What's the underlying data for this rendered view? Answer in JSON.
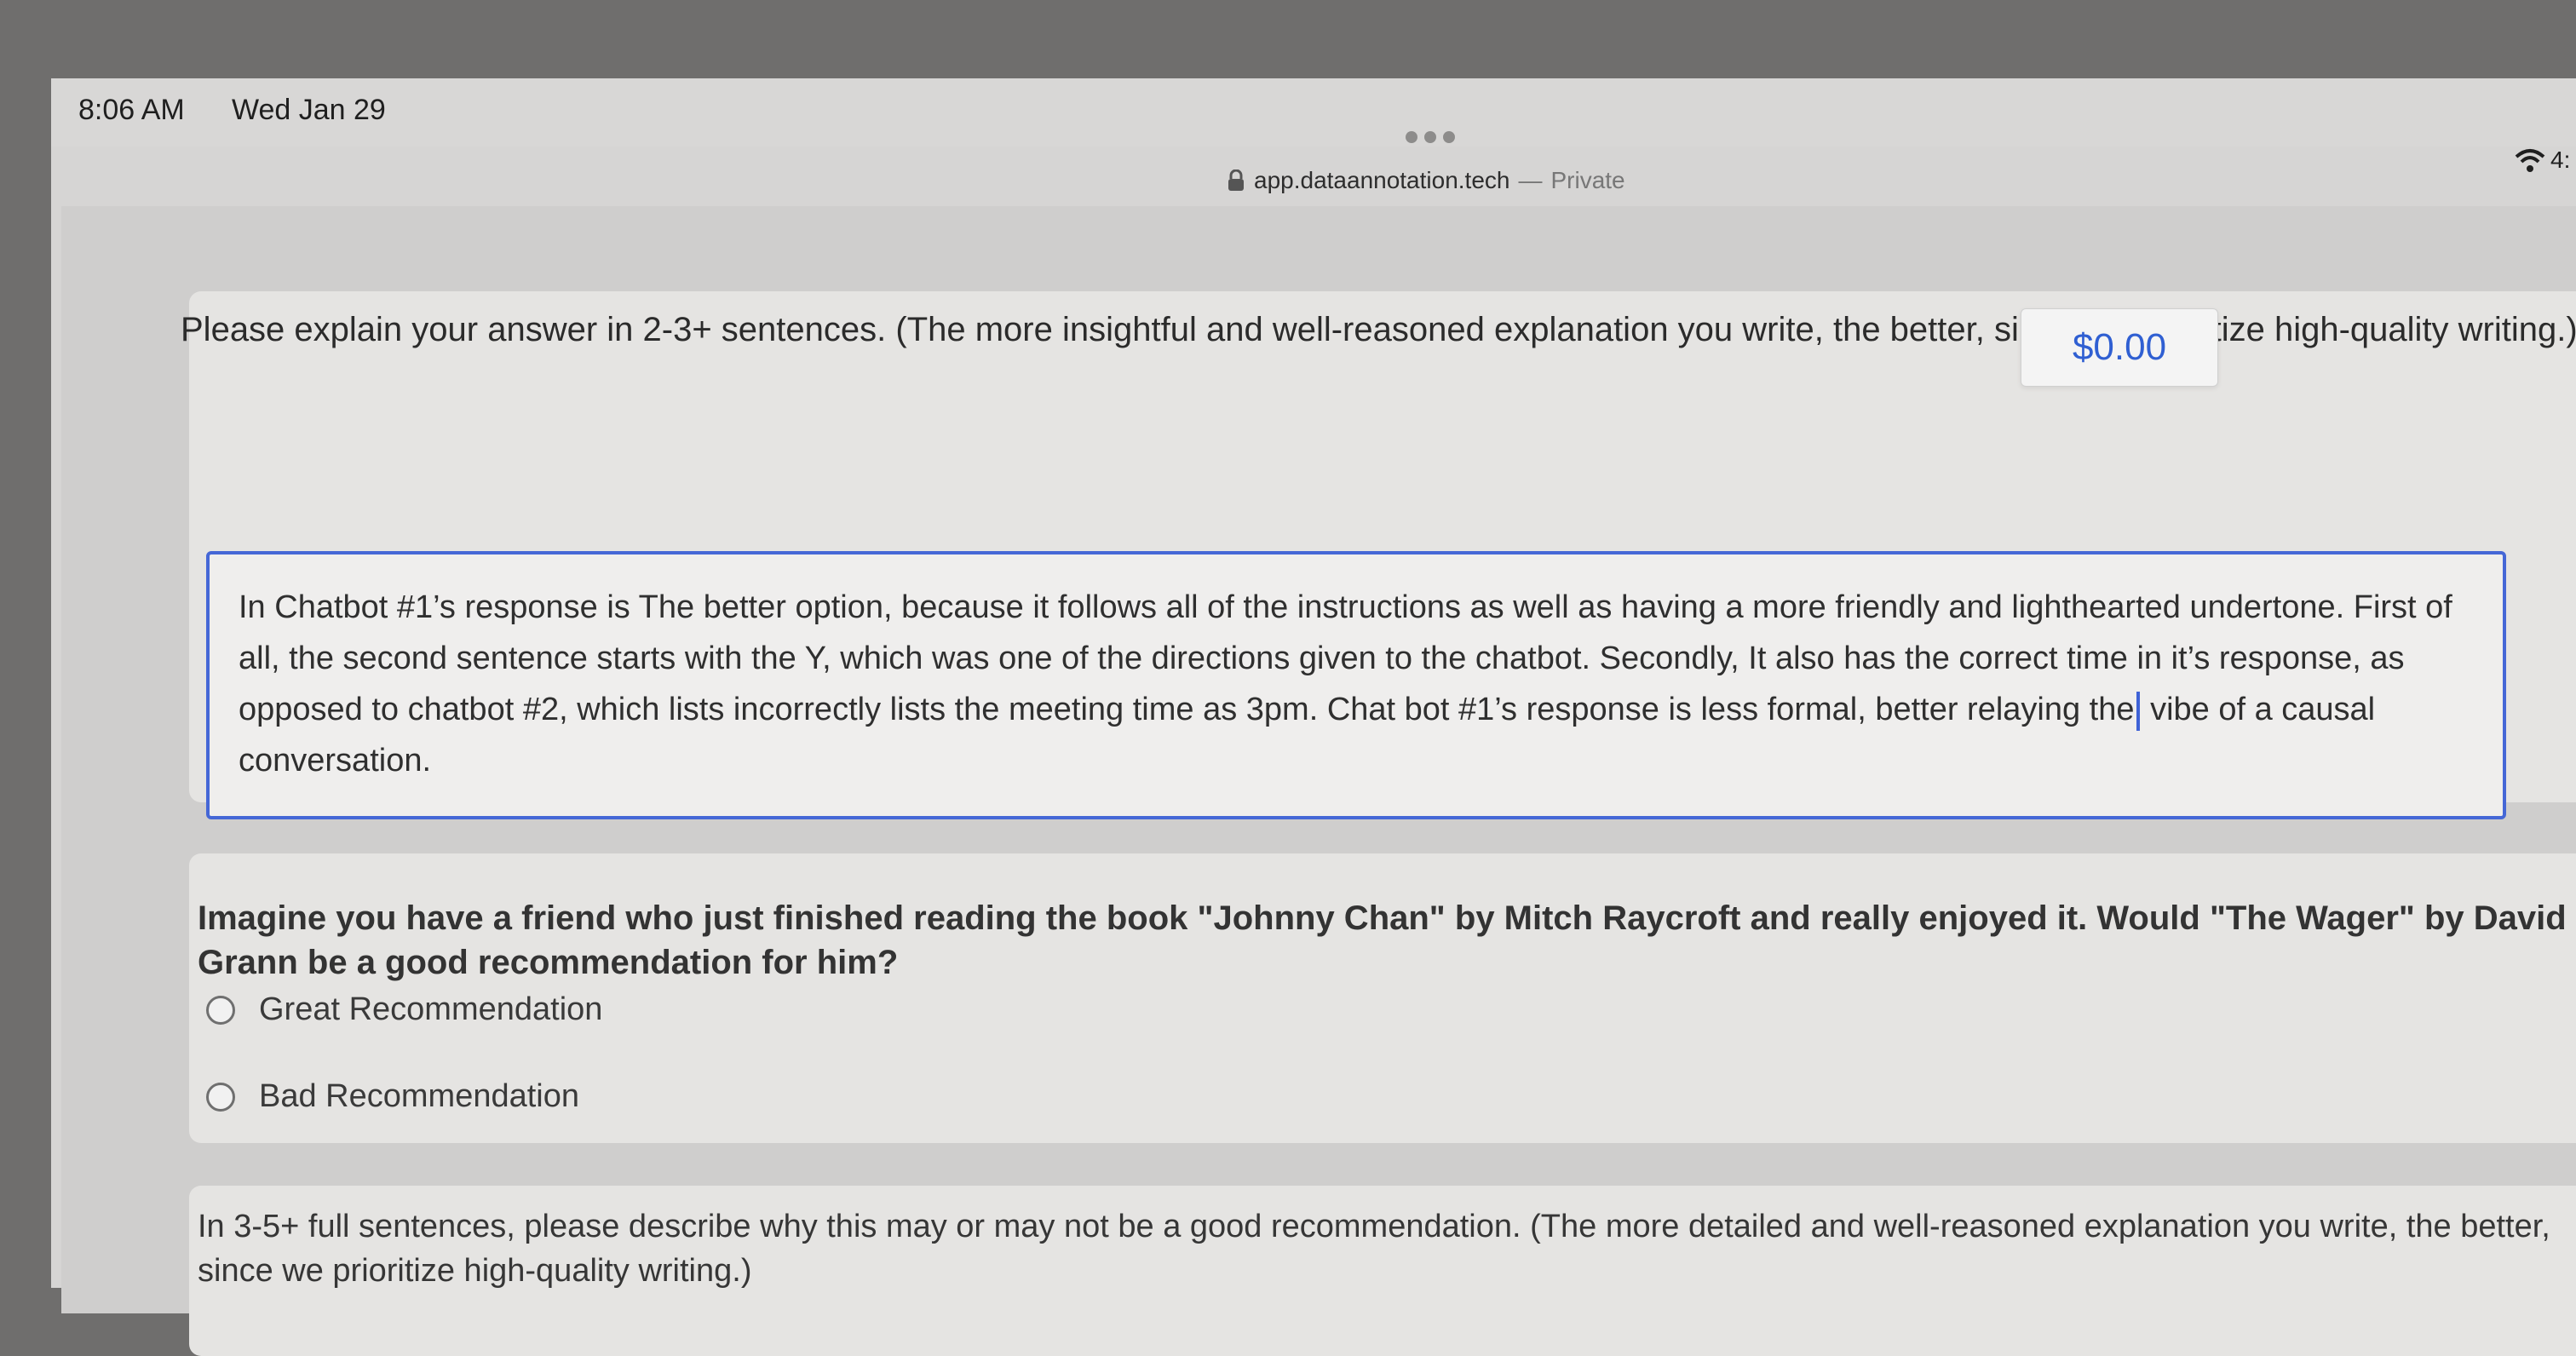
{
  "status_bar": {
    "time": "8:06 AM",
    "date": "Wed Jan 29",
    "battery": "4:"
  },
  "browser": {
    "domain": "app.dataannotation.tech",
    "separator": "—",
    "private_label": "Private"
  },
  "task": {
    "prompt_text": "Please explain your answer in 2-3+ sentences. (The more insightful and well-reasoned explanation you write, the better, since we prioritize high-quality writing.)",
    "price_badge": "$0.00",
    "answer_text_before_cursor": "In Chatbot #1’s  response is The better option, because it follows all of the instructions as well as having a more friendly and lighthearted undertone. First of all, the second sentence starts with the Y, which was one of the directions given to the chatbot. Secondly, It also has the correct time in it’s response, as opposed to chatbot #2, which lists incorrectly lists the meeting time as 3pm. Chat bot #1’s response is less formal, better relaying the",
    "answer_text_after_cursor": " vibe of a causal conversation."
  },
  "recommendation_question": {
    "question": "Imagine you have a friend who just finished reading the book \"Johnny Chan\" by Mitch Raycroft and really enjoyed it. Would \"The Wager\" by David Grann be a good recommendation for him?",
    "options": [
      {
        "label": "Great Recommendation",
        "selected": false
      },
      {
        "label": "Bad Recommendation",
        "selected": false
      }
    ]
  },
  "followup": {
    "instructions": "In 3-5+ full sentences, please describe why this may or may not be a good recommendation. (The more detailed and well-reasoned explanation you write, the better, since we prioritize high-quality writing.)"
  },
  "colors": {
    "accent_blue": "#4567d6",
    "price_blue": "#2f5fd2"
  }
}
